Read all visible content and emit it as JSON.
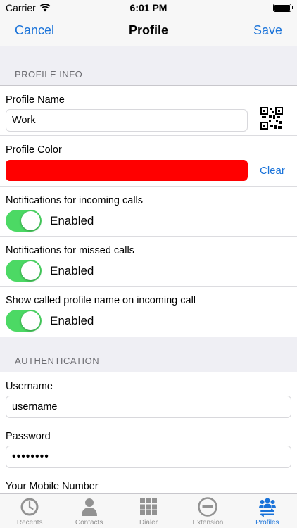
{
  "status_bar": {
    "carrier": "Carrier",
    "time": "6:01 PM"
  },
  "nav": {
    "cancel_label": "Cancel",
    "title": "Profile",
    "save_label": "Save"
  },
  "sections": {
    "profile_info": {
      "header": "PROFILE INFO",
      "profile_name_label": "Profile Name",
      "profile_name_value": "Work",
      "profile_color_label": "Profile Color",
      "profile_color_value": "#ff0000",
      "clear_label": "Clear",
      "toggles": [
        {
          "label": "Notifications for incoming calls",
          "state_text": "Enabled"
        },
        {
          "label": "Notifications for missed calls",
          "state_text": "Enabled"
        },
        {
          "label": "Show called profile name on incoming call",
          "state_text": "Enabled"
        }
      ]
    },
    "authentication": {
      "header": "AUTHENTICATION",
      "username_label": "Username",
      "username_value": "username",
      "password_label": "Password",
      "password_value": "••••••••",
      "mobile_label": "Your Mobile Number"
    }
  },
  "tab_bar": {
    "active": "Profiles",
    "tabs": [
      {
        "label": "Recents",
        "icon": "clock-icon"
      },
      {
        "label": "Contacts",
        "icon": "person-icon"
      },
      {
        "label": "Dialer",
        "icon": "keypad-icon"
      },
      {
        "label": "Extension",
        "icon": "minus-circle-icon"
      },
      {
        "label": "Profiles",
        "icon": "people-swap-icon"
      }
    ]
  },
  "colors": {
    "accent": "#1a73d9",
    "switch_on": "#4cd964",
    "group_background": "#efeff4",
    "tab_inactive": "#929292"
  }
}
